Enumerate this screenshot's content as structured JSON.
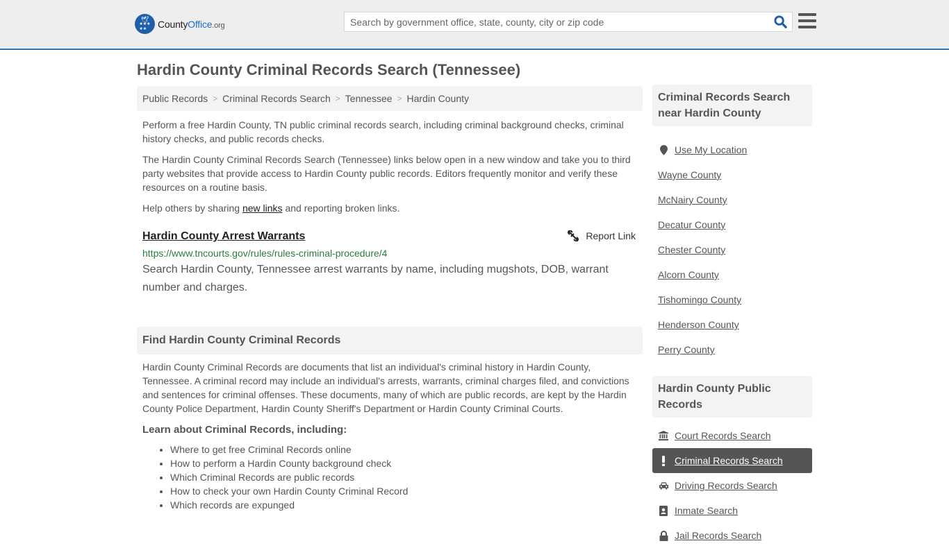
{
  "header": {
    "logo": {
      "county": "County",
      "office": "Office",
      "org": ".org"
    },
    "search_placeholder": "Search by government office, state, county, city or zip code",
    "search_icon": "search-icon",
    "menu_icon": "hamburger-menu-icon"
  },
  "page_title": "Hardin County Criminal Records Search (Tennessee)",
  "breadcrumb": [
    {
      "label": "Public Records"
    },
    {
      "label": "Criminal Records Search"
    },
    {
      "label": "Tennessee"
    },
    {
      "label": "Hardin County"
    }
  ],
  "intro": {
    "p1": "Perform a free Hardin County, TN public criminal records search, including criminal background checks, criminal history checks, and public records checks.",
    "p2": "The Hardin County Criminal Records Search (Tennessee) links below open in a new window and take you to third party websites that provide access to Hardin County public records. Editors frequently monitor and verify these resources on a routine basis.",
    "p3_before": "Help others by sharing ",
    "p3_link": "new links",
    "p3_after": " and reporting broken links."
  },
  "results": [
    {
      "title": "Hardin County Arrest Warrants",
      "report_label": "Report Link",
      "url": "https://www.tncourts.gov/rules/rules-criminal-procedure/4",
      "description": "Search Hardin County, Tennessee arrest warrants by name, including mugshots, DOB, warrant number and charges."
    }
  ],
  "find_section": {
    "heading": "Find Hardin County Criminal Records",
    "body": "Hardin County Criminal Records are documents that list an individual's criminal history in Hardin County, Tennessee. A criminal record may include an individual's arrests, warrants, criminal charges filed, and convictions and sentences for criminal offenses. These documents, many of which are public records, are kept by the Hardin County Police Department, Hardin County Sheriff's Department or Hardin County Criminal Courts.",
    "learn_heading": "Learn about Criminal Records, including:",
    "learn_items": [
      "Where to get free Criminal Records online",
      "How to perform a Hardin County background check",
      "Which Criminal Records are public records",
      "How to check your own Hardin County Criminal Record",
      "Which records are expunged"
    ]
  },
  "sidebar": {
    "nearby_heading": "Criminal Records Search near Hardin County",
    "use_location": "Use My Location",
    "nearby": [
      "Wayne County",
      "McNairy County",
      "Decatur County",
      "Chester County",
      "Alcorn County",
      "Tishomingo County",
      "Henderson County",
      "Perry County"
    ],
    "public_heading": "Hardin County Public Records",
    "public_records": [
      {
        "label": "Court Records Search",
        "icon": "courthouse-icon",
        "active": false
      },
      {
        "label": "Criminal Records Search",
        "icon": "exclamation-icon",
        "active": true
      },
      {
        "label": "Driving Records Search",
        "icon": "car-icon",
        "active": false
      },
      {
        "label": "Inmate Search",
        "icon": "id-badge-icon",
        "active": false
      },
      {
        "label": "Jail Records Search",
        "icon": "lock-icon",
        "active": false
      }
    ]
  },
  "colors": {
    "brand_blue": "#1d5fa8",
    "header_border": "#2f74ae",
    "url_green": "#2a7d3a",
    "active_bg": "#555555"
  }
}
